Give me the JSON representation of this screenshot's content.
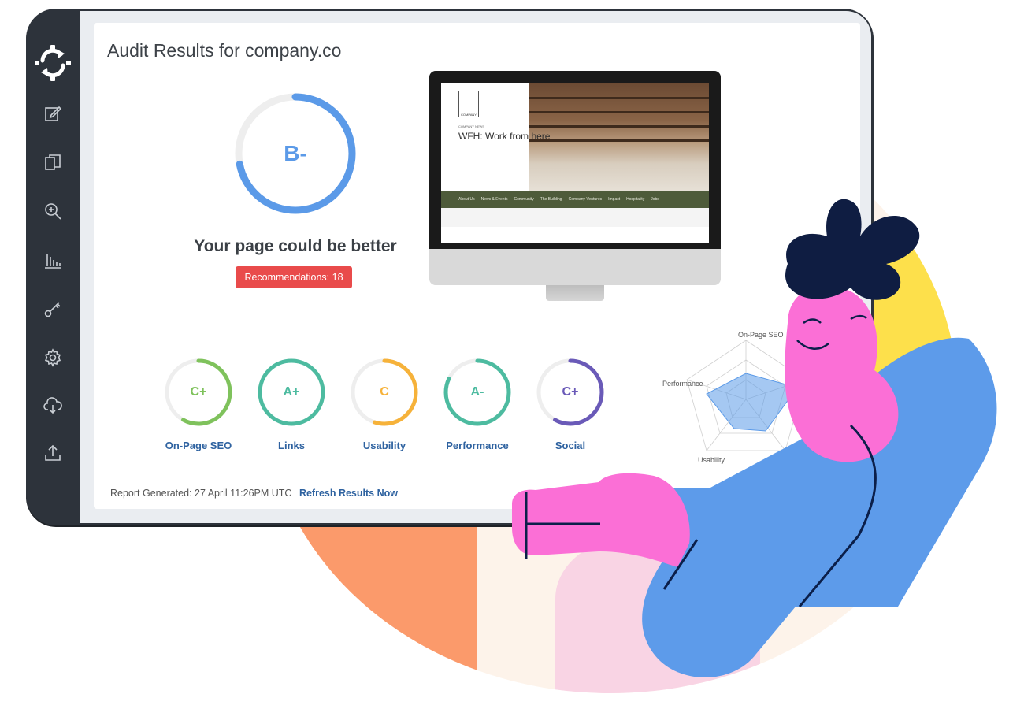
{
  "sidebar": {
    "items": [
      {
        "icon": "edit-icon"
      },
      {
        "icon": "copy-icon"
      },
      {
        "icon": "zoom-in-icon"
      },
      {
        "icon": "bar-chart-icon"
      },
      {
        "icon": "key-icon"
      },
      {
        "icon": "gear-icon"
      },
      {
        "icon": "cloud-download-icon"
      },
      {
        "icon": "upload-icon"
      }
    ]
  },
  "header": {
    "title": "Audit Results for company.co"
  },
  "overall": {
    "grade": "B-",
    "score_fraction": 0.72,
    "headline": "Your page could be better",
    "recommendations_label": "Recommendations: 18"
  },
  "preview": {
    "logo_text": "COMPANY",
    "small_text": "COMPANY NEWS",
    "headline": "WFH: Work from here",
    "nav": [
      "About Us",
      "News & Events",
      "Community",
      "The Building",
      "Company Ventures",
      "Impact",
      "Hospitality",
      "Jobs"
    ]
  },
  "scores": [
    {
      "label": "On-Page SEO",
      "grade": "C+",
      "fraction": 0.58,
      "color": "#7fc25c"
    },
    {
      "label": "Links",
      "grade": "A+",
      "fraction": 1.0,
      "color": "#4dbba0"
    },
    {
      "label": "Usability",
      "grade": "C",
      "fraction": 0.55,
      "color": "#f6b23a"
    },
    {
      "label": "Performance",
      "grade": "A-",
      "fraction": 0.82,
      "color": "#4dbba0"
    },
    {
      "label": "Social",
      "grade": "C+",
      "fraction": 0.58,
      "color": "#6a5ab8"
    }
  ],
  "radar": {
    "labels": [
      "On-Page SEO",
      "Performance",
      "Usability"
    ],
    "fill_color": "#5b9ae8"
  },
  "footer": {
    "generated": "Report Generated: 27 April 11:26PM UTC",
    "refresh_label": "Refresh Results Now"
  },
  "colors": {
    "accent": "#5b9ae8",
    "sidebar": "#2d333b",
    "badge": "#e94b4b",
    "link": "#2e62a0"
  }
}
